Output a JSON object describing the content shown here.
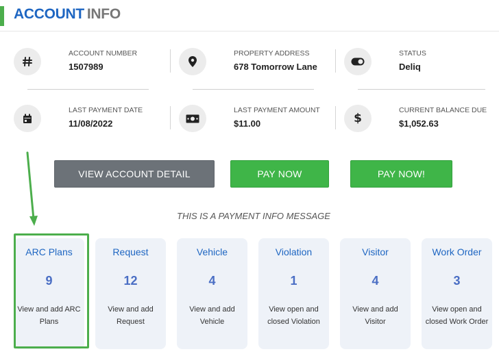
{
  "header": {
    "title_part1": "ACCOUNT",
    "title_part2": "INFO"
  },
  "info": [
    {
      "label": "ACCOUNT NUMBER",
      "value": "1507989",
      "icon": "hash-icon"
    },
    {
      "label": "PROPERTY ADDRESS",
      "value": "678 Tomorrow Lane",
      "icon": "map-pin-icon"
    },
    {
      "label": "STATUS",
      "value": "Deliq",
      "icon": "toggle-icon"
    },
    {
      "label": "LAST PAYMENT DATE",
      "value": "11/08/2022",
      "icon": "calendar-icon"
    },
    {
      "label": "LAST PAYMENT AMOUNT",
      "value": "$11.00",
      "icon": "money-bill-icon"
    },
    {
      "label": "CURRENT BALANCE DUE",
      "value": "$1,052.63",
      "icon": "dollar-icon"
    }
  ],
  "buttons": {
    "view_account_detail": "VIEW ACCOUNT DETAIL",
    "pay_now": "PAY NOW",
    "pay_now_alt": "PAY NOW!"
  },
  "message": "THIS IS A PAYMENT INFO MESSAGE",
  "cards": [
    {
      "title": "ARC Plans",
      "count": "9",
      "desc": "View and add ARC Plans"
    },
    {
      "title": "Request",
      "count": "12",
      "desc": "View and add Request"
    },
    {
      "title": "Vehicle",
      "count": "4",
      "desc": "View and add Vehicle"
    },
    {
      "title": "Violation",
      "count": "1",
      "desc": "View open and closed Violation"
    },
    {
      "title": "Visitor",
      "count": "4",
      "desc": "View and add Visitor"
    },
    {
      "title": "Work Order",
      "count": "3",
      "desc": "View open and closed Work Order"
    }
  ],
  "colors": {
    "accent_blue": "#1e66c2",
    "accent_green": "#3fb548",
    "button_gray": "#6c7278",
    "highlight_green": "#4cae4c"
  }
}
